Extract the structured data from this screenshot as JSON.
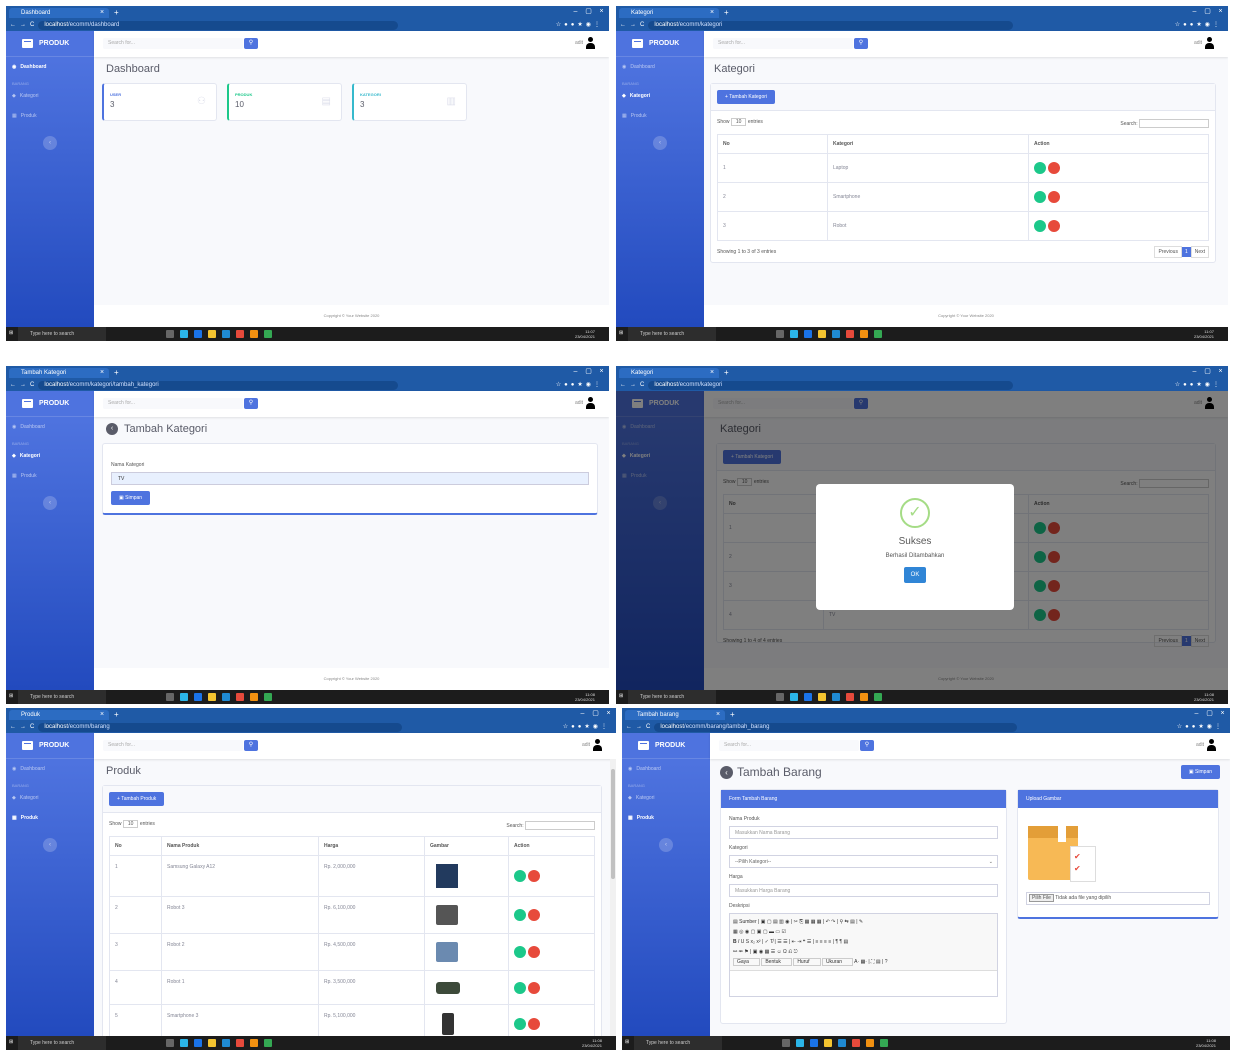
{
  "common": {
    "brand": "PRODUK",
    "nav_dashboard": "Dashboard",
    "nav_heading": "BARANG",
    "nav_kategori": "Kategori",
    "nav_produk": "Produk",
    "search_placeholder": "Search for...",
    "user": "adit",
    "footer": "Copyright © Your Website 2020",
    "taskbar_search": "Type here to search",
    "url_host": "localhost",
    "accent": "#4e73df"
  },
  "shot1": {
    "tab_title": "Dashboard",
    "url_path": "/ecomm/dashboard",
    "page_title": "Dashboard",
    "time": "11:07",
    "date": "23/04/2021",
    "cards": [
      {
        "label": "USER",
        "value": "3",
        "color": "#4e73df"
      },
      {
        "label": "PRODUK",
        "value": "10",
        "color": "#1cc88a"
      },
      {
        "label": "KATEGORI",
        "value": "3",
        "color": "#36b9cc"
      }
    ]
  },
  "shot2": {
    "tab_title": "Kategori",
    "url_path": "/ecomm/kategori",
    "page_title": "Kategori",
    "add_button": "Tambah Kategori",
    "show_label": "Show",
    "show_value": "10",
    "entries_label": "entries",
    "search_label": "Search:",
    "columns": [
      "No",
      "Kategori",
      "Action"
    ],
    "rows": [
      {
        "no": "1",
        "name": "Laptop"
      },
      {
        "no": "2",
        "name": "Smartphone"
      },
      {
        "no": "3",
        "name": "Robot"
      }
    ],
    "info": "Showing 1 to 3 of 3 entries",
    "prev": "Previous",
    "page": "1",
    "next": "Next",
    "time": "11:07",
    "date": "23/04/2021"
  },
  "shot3": {
    "tab_title": "Tambah Kategori",
    "url_path": "/ecomm/kategori/tambah_kategori",
    "page_title": "Tambah Kategori",
    "field_label": "Nama Kategori",
    "field_value": "TV",
    "save_button": "Simpan"
  },
  "shot4": {
    "tab_title": "Kategori",
    "url_path": "/ecomm/kategori",
    "page_title": "Kategori",
    "add_button": "Tambah Kategori",
    "modal_title": "Sukses",
    "modal_text": "Berhasil Ditambahkan",
    "modal_ok": "OK",
    "rows": [
      "1",
      "2",
      "3",
      "4"
    ],
    "row4_name": "TV",
    "info": "Showing 1 to 4 of 4 entries",
    "time": "11:08",
    "date": "23/04/2021"
  },
  "shot5": {
    "tab_title": "Produk",
    "url_path": "/ecomm/barang",
    "page_title": "Produk",
    "add_button": "Tambah Produk",
    "columns": [
      "No",
      "Nama Produk",
      "Harga",
      "Gambar",
      "Action"
    ],
    "rows": [
      {
        "no": "1",
        "name": "Samsung Galaxy A12",
        "price": "Rp. 2,000,000"
      },
      {
        "no": "2",
        "name": "Robot 3",
        "price": "Rp. 6,100,000"
      },
      {
        "no": "3",
        "name": "Robot 2",
        "price": "Rp. 4,500,000"
      },
      {
        "no": "4",
        "name": "Robot 1",
        "price": "Rp. 3,500,000"
      },
      {
        "no": "5",
        "name": "Smartphone 3",
        "price": "Rp. 5,100,000"
      }
    ],
    "time": "11:08",
    "date": "23/04/2021"
  },
  "shot6": {
    "tab_title": "Tambah barang",
    "url_path": "/ecomm/barang/tambah_barang",
    "page_title": "Tambah Barang",
    "save_button": "Simpan",
    "form_header": "Form Tambah Barang",
    "upload_header": "Upload Gambar",
    "label_nama": "Nama Produk",
    "ph_nama": "Masukkan Nama Barang",
    "label_kategori": "Kategori",
    "select_kategori": "--Pilih Kategori--",
    "label_harga": "Harga",
    "ph_harga": "Masukkan Harga Barang",
    "label_deskripsi": "Deskripsi",
    "editor_source": "Sumber",
    "editor_gaya": "Gaya",
    "editor_bentuk": "Bentuk",
    "editor_huruf": "Huruf",
    "editor_ukuran": "Ukuran",
    "file_button": "Pilih File",
    "file_text": "Tidak ada file yang dipilih",
    "time": "11:08",
    "date": "23/04/2021"
  }
}
